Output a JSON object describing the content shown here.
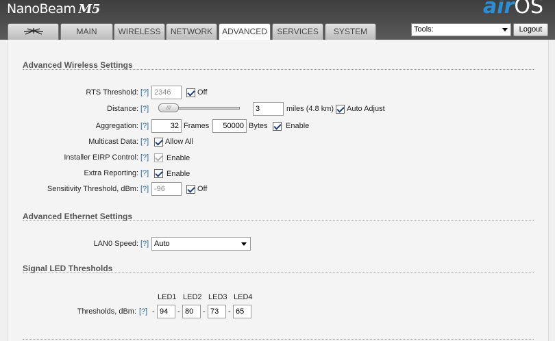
{
  "brand": {
    "name": "NanoBeam",
    "model": "M5",
    "logo_air": "air",
    "logo_os": "OS"
  },
  "tabs": [
    "MAIN",
    "WIRELESS",
    "NETWORK",
    "ADVANCED",
    "SERVICES",
    "SYSTEM"
  ],
  "active_tab": "ADVANCED",
  "tools": {
    "value": "Tools:"
  },
  "logout_label": "Logout",
  "help_label": "[?]",
  "wireless": {
    "title": "Advanced Wireless Settings",
    "rts": {
      "label": "RTS Threshold:",
      "value": "2346",
      "off_label": "Off",
      "off_checked": true
    },
    "distance": {
      "label": "Distance:",
      "value": "3",
      "unit": "miles (4.8 km)",
      "auto_label": "Auto Adjust",
      "auto_checked": true,
      "slider_grip": "///"
    },
    "aggregation": {
      "label": "Aggregation:",
      "frames": "32",
      "frames_label": "Frames",
      "bytes": "50000",
      "bytes_label": "Bytes",
      "enable_label": "Enable",
      "enable_checked": true
    },
    "multicast": {
      "label": "Multicast Data:",
      "allow_label": "Allow All",
      "checked": true
    },
    "eirp": {
      "label": "Installer EIRP Control:",
      "enable_label": "Enable",
      "checked": true
    },
    "extra": {
      "label": "Extra Reporting:",
      "enable_label": "Enable",
      "checked": true
    },
    "sensitivity": {
      "label": "Sensitivity Threshold, dBm:",
      "value": "-96",
      "off_label": "Off",
      "off_checked": true
    }
  },
  "ethernet": {
    "title": "Advanced Ethernet Settings",
    "lan0": {
      "label": "LAN0 Speed:",
      "value": "Auto"
    }
  },
  "led": {
    "title": "Signal LED Thresholds",
    "headers": [
      "LED1",
      "LED2",
      "LED3",
      "LED4"
    ],
    "label": "Thresholds, dBm:",
    "prefix": "-",
    "values": [
      "94",
      "80",
      "73",
      "65"
    ]
  }
}
